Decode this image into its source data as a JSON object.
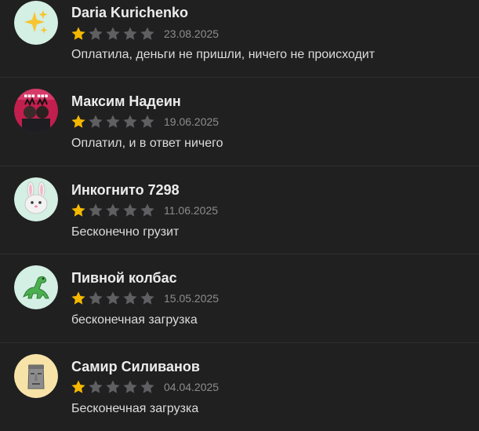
{
  "colors": {
    "background": "#202021",
    "star_filled": "#f5b800",
    "star_empty": "#5f5f62"
  },
  "reviews": [
    {
      "author": "Daria Kurichenko",
      "rating": 1,
      "max_rating": 5,
      "date": "23.08.2025",
      "text": "Оплатила, деньги не пришли, ничего не происходит",
      "avatar_icon": "sparkles-icon"
    },
    {
      "author": "Максим Надеин",
      "rating": 1,
      "max_rating": 5,
      "date": "19.06.2025",
      "text": "Оплатил, и в ответ ничего",
      "avatar_icon": "photo-avatar"
    },
    {
      "author": "Инкогнито 7298",
      "rating": 1,
      "max_rating": 5,
      "date": "11.06.2025",
      "text": "Бесконечно грузит",
      "avatar_icon": "rabbit-icon"
    },
    {
      "author": "Пивной колбас",
      "rating": 1,
      "max_rating": 5,
      "date": "15.05.2025",
      "text": "бесконечная загрузка",
      "avatar_icon": "dinosaur-icon"
    },
    {
      "author": "Самир Силиванов",
      "rating": 1,
      "max_rating": 5,
      "date": "04.04.2025",
      "text": "Бесконечная загрузка",
      "avatar_icon": "moai-icon"
    }
  ]
}
